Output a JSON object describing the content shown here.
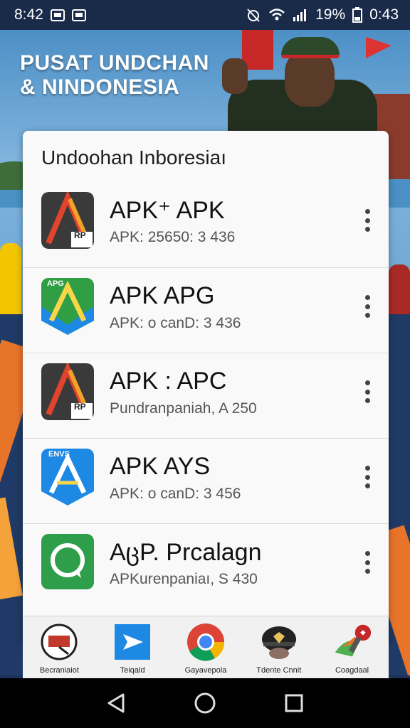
{
  "status_bar": {
    "time": "8:42",
    "battery": "19%",
    "clock_right": "0:43"
  },
  "banner": {
    "title_line1": "PUSAT UNDCHAN",
    "title_line2": "& NINDONESIA"
  },
  "card": {
    "title": "Undoohan Inboresiaı",
    "apps": [
      {
        "name": "APK⁺ APK",
        "subtitle": "APK: 25650: 3 436",
        "icon": "dark-red-a-icon",
        "icon_badge": "RP"
      },
      {
        "name": "APK APG",
        "subtitle": "APK: o canD: 3 436",
        "icon": "green-blue-a-icon",
        "icon_badge": "APG"
      },
      {
        "name": "APK : APC",
        "subtitle": "Pundranpaniah, A 250",
        "icon": "dark-red-a-icon",
        "icon_badge": "RP"
      },
      {
        "name": "APK AYS",
        "subtitle": "APK: o canD: 3 456",
        "icon": "blue-a-icon",
        "icon_badge": "ENVS"
      },
      {
        "name": "AცP. Prcalagn",
        "subtitle": "APKurenpaniaı, S 430",
        "icon": "green-chat-icon",
        "icon_badge": ""
      }
    ]
  },
  "dock": [
    {
      "label": "Becraniaiot",
      "icon": "clock-icon"
    },
    {
      "label": "Teiqald",
      "icon": "play-arrow-icon"
    },
    {
      "label": "Gayavepola",
      "icon": "chrome-icon"
    },
    {
      "label": "Tdente Cnnit",
      "icon": "soldier-helmet-icon"
    },
    {
      "label": "Coagdaal",
      "icon": "flag-badge-icon"
    }
  ],
  "colors": {
    "status_bar_bg": "#1a2b4a",
    "card_bg": "#f9f9f9",
    "accent_orange": "#e8742a",
    "accent_green": "#43a047",
    "accent_blue": "#1e88e5"
  }
}
